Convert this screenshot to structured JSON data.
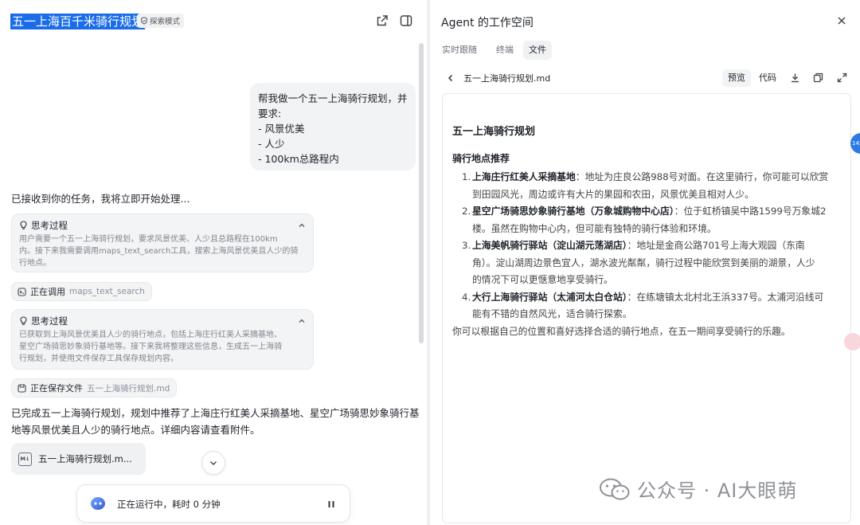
{
  "chat": {
    "title": "五一上海百千米骑行规划",
    "mode_badge": "探索模式",
    "user_message": [
      "帮我做一个五一上海骑行规划，并",
      "要求:",
      "- 风景优美",
      "- 人少",
      "- 100km总路程内"
    ],
    "ack_text": "已接收到你的任务，我将立即开始处理...",
    "think1": {
      "label": "思考过程",
      "lines": [
        "用户需要一个五一上海骑行规划，要求风景优美、人少且总路程在100km",
        "内。接下来我需要调用maps_text_search工具，搜索上海风景优美且人少的骑",
        "行地点。"
      ]
    },
    "tool1": {
      "label": "正在调用",
      "value": "maps_text_search"
    },
    "think2": {
      "label": "思考过程",
      "lines": [
        "已获取到上海风景优美且人少的骑行地点，包括上海庄行红美人采摘基地、",
        "星空广场骑思妙象骑行基地等。接下来我将整理这些信息，生成五一上海骑",
        "行规划，并使用文件保存工具保存规划内容。"
      ]
    },
    "tool2": {
      "label": "正在保存文件",
      "value": "五一上海骑行规划.md"
    },
    "result_lines": [
      "已完成五一上海骑行规划，规划中推荐了上海庄行红美人采摘基地、星空广场骑思妙象骑行基",
      "地等风景优美且人少的骑行地点。详细内容请查看附件。"
    ],
    "attachment": {
      "icon_text": "M↓",
      "name": "五一上海骑行规划.m..."
    },
    "status": "正在运行中，耗时 0 分钟"
  },
  "workspace": {
    "title": "Agent 的工作空间",
    "tabs": [
      {
        "label": "实时跟随",
        "active": false
      },
      {
        "label": "终端",
        "active": false
      },
      {
        "label": "文件",
        "active": true
      }
    ],
    "file_name": "五一上海骑行规划.md",
    "view_preview": "预览",
    "view_code": "代码",
    "doc": {
      "h1": "五一上海骑行规划",
      "h2": "骑行地点推荐",
      "items": [
        {
          "num": "1.",
          "title": "上海庄行红美人采摘基地",
          "lines": [
            "：地址为庄良公路988号对面。在这里骑行，你可能可以欣赏",
            "到田园风光，周边或许有大片的果园和农田，风景优美且相对人少。"
          ]
        },
        {
          "num": "2.",
          "title": "星空广场骑思妙象骑行基地（万象城购物中心店）",
          "lines": [
            "：位于虹桥镇吴中路1599号万象城2",
            "楼。虽然在购物中心内，但可能有独特的骑行体验和环境。"
          ]
        },
        {
          "num": "3.",
          "title": "上海美帆骑行驿站（淀山湖元荡湖店）",
          "lines": [
            "：地址是金商公路701号上海大观园（东南",
            "角）。淀山湖周边景色宜人，湖水波光粼粼，骑行过程中能欣赏到美丽的湖景，人少",
            "的情况下可以更惬意地享受骑行。"
          ]
        },
        {
          "num": "4.",
          "title": "大行上海骑行驿站（太浦河太白仓站）",
          "lines": [
            "：在练塘镇太北村北王浜337号。太浦河沿线可",
            "能有不错的自然风光，适合骑行探索。"
          ]
        }
      ],
      "closing": "你可以根据自己的位置和喜好选择合适的骑行地点，在五一期间享受骑行的乐趣。"
    },
    "side_tab": "145"
  },
  "watermark": "公众号 · AI大眼萌"
}
